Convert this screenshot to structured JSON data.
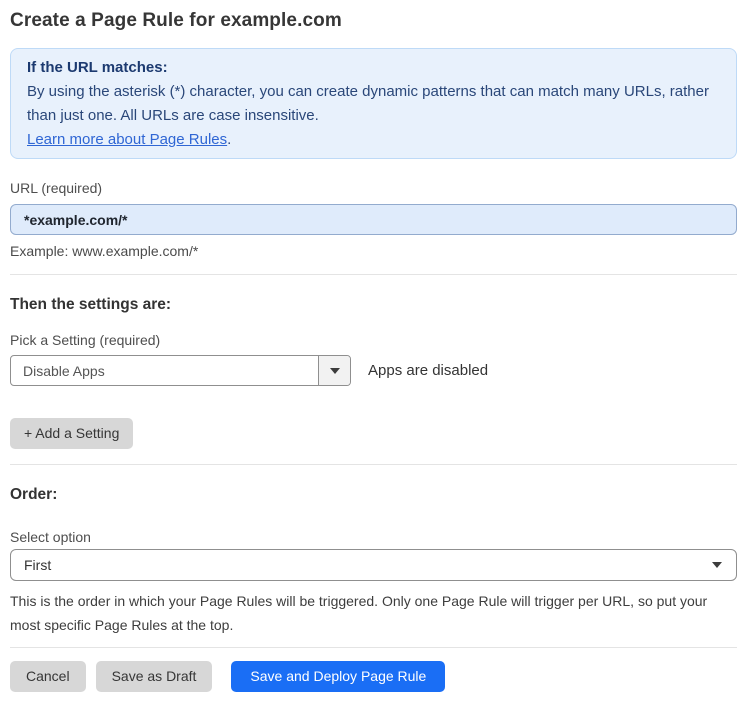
{
  "page": {
    "title": "Create a Page Rule for example.com"
  },
  "info_box": {
    "heading": "If the URL matches:",
    "body": "By using the asterisk (*) character, you can create dynamic patterns that can match many URLs, rather than just one. All URLs are case insensitive.",
    "link_label": "Learn more about Page Rules",
    "link_suffix": "."
  },
  "url_field": {
    "label": "URL (required)",
    "value": "*example.com/*",
    "example": "Example: www.example.com/*"
  },
  "settings_section": {
    "heading": "Then the settings are:",
    "setting_label": "Pick a Setting (required)",
    "setting_value": "Disable Apps",
    "setting_status": "Apps are disabled",
    "add_setting_label": "+ Add a Setting"
  },
  "order_section": {
    "heading": "Order:",
    "select_label": "Select option",
    "select_value": "First",
    "help_text": "This is the order in which your Page Rules will be triggered. Only one Page Rule will trigger per URL, so put your most specific Page Rules at the top."
  },
  "footer": {
    "cancel_label": "Cancel",
    "save_draft_label": "Save as Draft",
    "save_deploy_label": "Save and Deploy Page Rule"
  },
  "icons": {
    "dropdown_caret": "chevron-down-icon"
  },
  "colors": {
    "primary_button": "#1a6ef5",
    "info_box_background": "#e8f1fc",
    "info_box_border": "#bedaf7",
    "info_text": "#1c3a70",
    "link": "#2f66d4",
    "url_input_background": "#dfebfb",
    "url_input_border": "#93abce",
    "gray_button": "#d7d7d7",
    "control_border": "#8f8f8f",
    "divider": "#e4e4e4"
  }
}
